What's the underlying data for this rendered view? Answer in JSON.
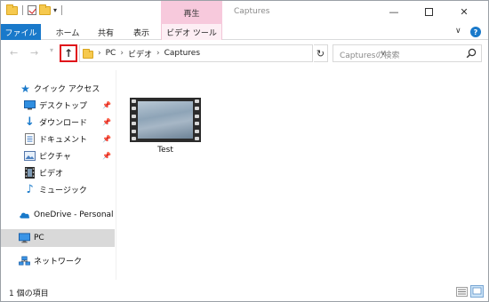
{
  "titlebar": {
    "context_tab_label": "再生",
    "window_title": "Captures"
  },
  "ribbon": {
    "tabs": [
      "ファイル",
      "ホーム",
      "共有",
      "表示",
      "ビデオ ツール"
    ]
  },
  "address": {
    "crumbs": [
      "PC",
      "ビデオ",
      "Captures"
    ]
  },
  "search": {
    "placeholder": "Capturesの検索"
  },
  "sidebar": {
    "quick_access": "クイック アクセス",
    "items": [
      {
        "label": "デスクトップ",
        "icon": "desktop-icon",
        "pinned": true
      },
      {
        "label": "ダウンロード",
        "icon": "download-icon",
        "pinned": true
      },
      {
        "label": "ドキュメント",
        "icon": "document-icon",
        "pinned": true
      },
      {
        "label": "ピクチャ",
        "icon": "picture-icon",
        "pinned": true
      },
      {
        "label": "ビデオ",
        "icon": "video-icon",
        "pinned": false
      },
      {
        "label": "ミュージック",
        "icon": "music-icon",
        "pinned": false
      }
    ],
    "onedrive": "OneDrive - Personal",
    "pc": "PC",
    "network": "ネットワーク"
  },
  "files": [
    {
      "name": "Test",
      "type": "video"
    }
  ],
  "status": {
    "item_count": "1 個の項目"
  },
  "colors": {
    "file_tab": "#1979ca",
    "context_tab": "#f7c9dc",
    "up_highlight": "#e0141b",
    "selected_nav": "#d9d9d9"
  }
}
